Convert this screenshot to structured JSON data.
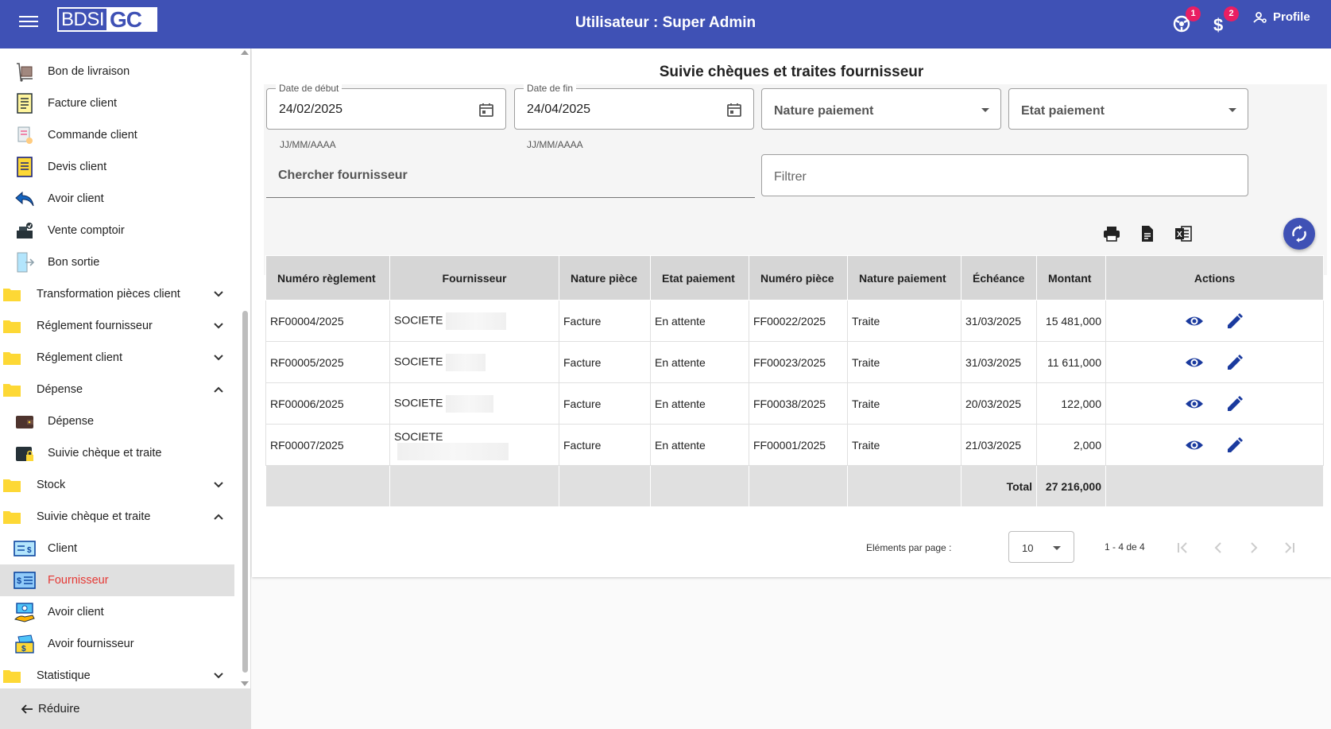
{
  "header": {
    "logo_left": "BDSI",
    "logo_right": "GC",
    "title": "Utilisateur : Super Admin",
    "notifications_count": "1",
    "payments_count": "2",
    "profile_label": "Profile"
  },
  "sidebar": {
    "items": [
      {
        "label": "Bon de livraison",
        "icon": "delivery-box-icon"
      },
      {
        "label": "Facture client",
        "icon": "invoice-icon"
      },
      {
        "label": "Commande client",
        "icon": "order-icon"
      },
      {
        "label": "Devis client",
        "icon": "quote-icon"
      },
      {
        "label": "Avoir client",
        "icon": "reply-arrow-icon"
      },
      {
        "label": "Vente comptoir",
        "icon": "cash-register-icon"
      },
      {
        "label": "Bon sortie",
        "icon": "exit-door-icon"
      },
      {
        "label": "Transformation pièces client",
        "icon": "folder-icon"
      },
      {
        "label": "Réglement fournisseur",
        "icon": "folder-icon"
      },
      {
        "label": "Réglement client",
        "icon": "folder-icon"
      },
      {
        "label": "Dépense",
        "icon": "folder-icon"
      },
      {
        "label": "Dépense",
        "icon": "wallet-icon"
      },
      {
        "label": "Suivie chèque et traite",
        "icon": "wallet-lock-icon"
      },
      {
        "label": "Stock",
        "icon": "folder-icon"
      },
      {
        "label": "Suivie chèque et traite",
        "icon": "folder-icon"
      },
      {
        "label": "Client",
        "icon": "cheque-icon"
      },
      {
        "label": "Fournisseur",
        "icon": "cheque-list-icon"
      },
      {
        "label": "Avoir client",
        "icon": "money-hand-icon"
      },
      {
        "label": "Avoir fournisseur",
        "icon": "money-box-icon"
      },
      {
        "label": "Statistique",
        "icon": "folder-icon"
      }
    ],
    "reduce_label": "Réduire"
  },
  "main": {
    "title": "Suivie chèques et traites fournisseur",
    "filters": {
      "date_start_label": "Date de début",
      "date_start_value": "24/02/2025",
      "date_end_label": "Date de fin",
      "date_end_value": "24/04/2025",
      "date_hint": "JJ/MM/AAAA",
      "nature_paiement_placeholder": "Nature paiement",
      "etat_paiement_placeholder": "Etat paiement",
      "search_supplier_placeholder": "Chercher fournisseur",
      "filter_placeholder": "Filtrer"
    },
    "table": {
      "headers": [
        "Numéro règlement",
        "Fournisseur",
        "Nature pièce",
        "Etat paiement",
        "Numéro pièce",
        "Nature paiement",
        "Échéance",
        "Montant",
        "Actions"
      ],
      "rows": [
        {
          "numero": "RF00004/2025",
          "fournisseur": "SOCIETE",
          "nature_piece": "Facture",
          "etat": "En attente",
          "numero_piece": "FF00022/2025",
          "nature_paiement": "Traite",
          "echeance": "31/03/2025",
          "montant": "15 481,000"
        },
        {
          "numero": "RF00005/2025",
          "fournisseur": "SOCIETE",
          "nature_piece": "Facture",
          "etat": "En attente",
          "numero_piece": "FF00023/2025",
          "nature_paiement": "Traite",
          "echeance": "31/03/2025",
          "montant": "11 611,000"
        },
        {
          "numero": "RF00006/2025",
          "fournisseur": "SOCIETE",
          "nature_piece": "Facture",
          "etat": "En attente",
          "numero_piece": "FF00038/2025",
          "nature_paiement": "Traite",
          "echeance": "20/03/2025",
          "montant": "122,000"
        },
        {
          "numero": "RF00007/2025",
          "fournisseur": "SOCIETE",
          "nature_piece": "Facture",
          "etat": "En attente",
          "numero_piece": "FF00001/2025",
          "nature_paiement": "Traite",
          "echeance": "21/03/2025",
          "montant": "2,000"
        }
      ],
      "total_label": "Total",
      "total_value": "27 216,000"
    },
    "paginator": {
      "per_page_label": "Eléments par page :",
      "per_page_value": "10",
      "range_label": "1 - 4 de 4"
    }
  },
  "colors": {
    "primary": "#3f51b5",
    "badge": "#e91e63",
    "active_text": "#e53935",
    "folder": "#fbc02d"
  }
}
